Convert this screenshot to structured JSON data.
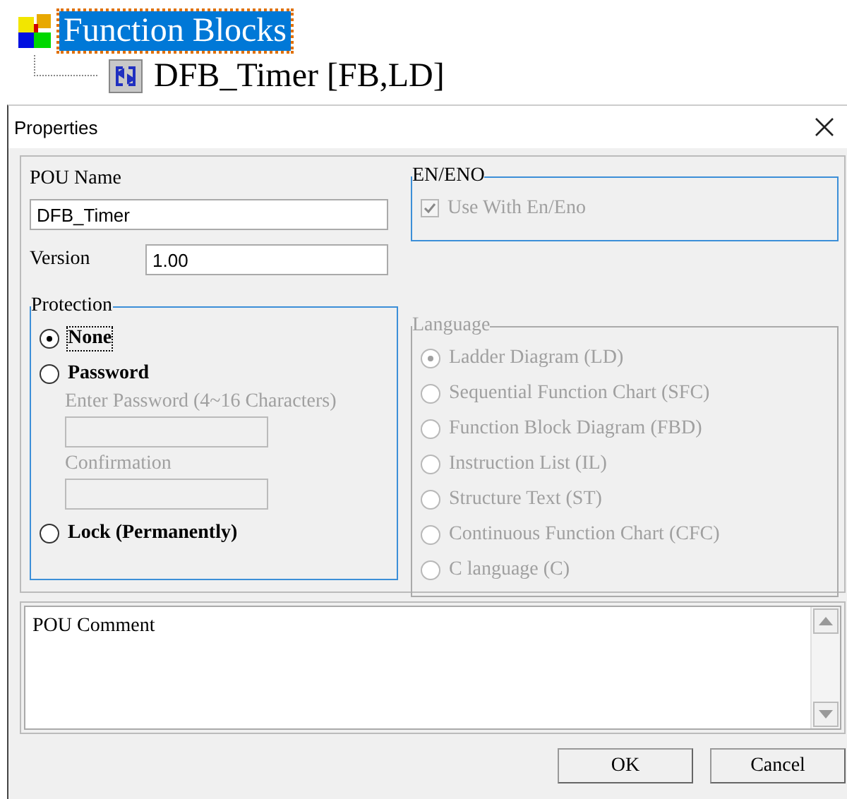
{
  "tree": {
    "label": "Function Blocks",
    "selected": true,
    "children": [
      {
        "label": "DFB_Timer [FB,LD]"
      }
    ]
  },
  "dialog": {
    "title": "Properties"
  },
  "pou_name": {
    "label": "POU Name",
    "value": "DFB_Timer"
  },
  "version": {
    "label": "Version",
    "value": "1.00"
  },
  "en_eno": {
    "title": "EN/ENO",
    "checkbox": {
      "label": "Use With En/Eno",
      "checked": true,
      "disabled": true
    }
  },
  "protection": {
    "title": "Protection",
    "options": [
      {
        "label": "None",
        "selected": true
      },
      {
        "label": "Password",
        "selected": false
      },
      {
        "label": "Lock (Permanently)",
        "selected": false
      }
    ],
    "password_field": {
      "label": "Enter Password (4~16 Characters)"
    },
    "confirmation_field": {
      "label": "Confirmation"
    }
  },
  "language": {
    "title": "Language",
    "disabled": true,
    "options": [
      {
        "label": "Ladder Diagram (LD)",
        "selected": true
      },
      {
        "label": "Sequential Function Chart (SFC)",
        "selected": false
      },
      {
        "label": "Function Block Diagram (FBD)",
        "selected": false
      },
      {
        "label": "Instruction List (IL)",
        "selected": false
      },
      {
        "label": "Structure Text (ST)",
        "selected": false
      },
      {
        "label": "Continuous Function Chart (CFC)",
        "selected": false
      },
      {
        "label": "C language (C)",
        "selected": false
      }
    ]
  },
  "comment": {
    "label": "POU Comment"
  },
  "buttons": [
    {
      "label": "OK"
    },
    {
      "label": "Cancel"
    }
  ]
}
